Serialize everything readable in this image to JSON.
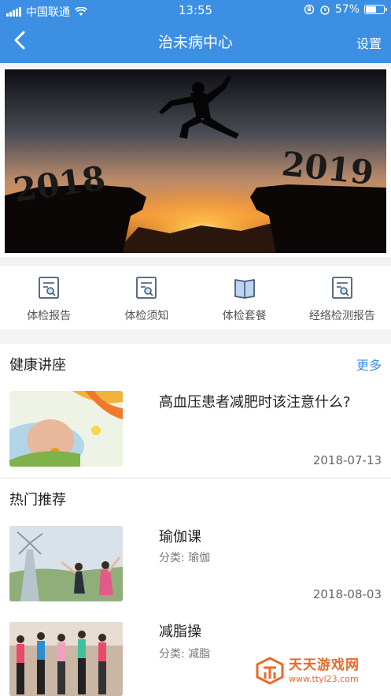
{
  "status_bar": {
    "carrier": "中国联通",
    "time": "13:55",
    "battery": "57%"
  },
  "nav": {
    "title": "治未病中心",
    "right_action": "设置"
  },
  "banner": {
    "left_year": "2018",
    "right_year": "2019"
  },
  "quick_menu": [
    {
      "label": "体检报告",
      "icon": "report-search-icon"
    },
    {
      "label": "体检须知",
      "icon": "notice-search-icon"
    },
    {
      "label": "体检套餐",
      "icon": "package-book-icon"
    },
    {
      "label": "经络检测报告",
      "icon": "meridian-report-icon"
    }
  ],
  "lectures": {
    "title": "健康讲座",
    "more": "更多",
    "items": [
      {
        "title": "高血压患者减肥时该注意什么?",
        "date": "2018-07-13"
      }
    ]
  },
  "hot": {
    "title": "热门推荐",
    "items": [
      {
        "title": "瑜伽课",
        "category": "分类: 瑜伽",
        "date": "2018-08-03"
      },
      {
        "title": "减脂操",
        "category": "分类: 减脂"
      }
    ]
  },
  "watermark": {
    "title": "天天游戏网",
    "url": "www.ttyl23.com"
  },
  "colors": {
    "primary": "#3d8fe3",
    "watermark": "#ea6a2a"
  }
}
